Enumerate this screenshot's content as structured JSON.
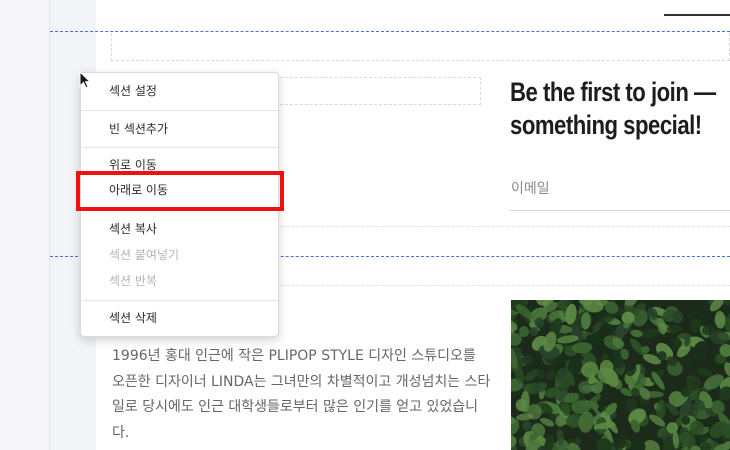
{
  "context_menu": {
    "items": [
      {
        "label": "섹션 설정",
        "enabled": true
      },
      {
        "label": "빈 섹션추가",
        "enabled": true
      },
      {
        "label": "위로 이동",
        "enabled": true
      },
      {
        "label": "아래로 이동",
        "enabled": true,
        "highlighted": true
      },
      {
        "label": "섹션 복사",
        "enabled": true
      },
      {
        "label": "섹션 붙여넣기",
        "enabled": false
      },
      {
        "label": "섹션 반복",
        "enabled": false
      },
      {
        "label": "섹션 삭제",
        "enabled": true
      }
    ]
  },
  "signup": {
    "headline_line1": "Be the first to join —",
    "headline_line2": "something special!",
    "email_placeholder": "이메일"
  },
  "about": {
    "description": "1996년 홍대 인근에 작은 PLIPOP STYLE 디자인 스튜디오를 오픈한 디자이너 LINDA는 그녀만의 차별적이고 개성넘치는 스타일로 당시에도 인근 대학생들로부터 많은 인기를 얻고 있었습니다."
  },
  "colors": {
    "highlight": "#ee1111",
    "selection_line": "#4a6fd8",
    "headline": "#1d1d1f",
    "foliage": "#2f4a2a"
  },
  "icons": {
    "cursor": "arrow-cursor-icon"
  }
}
